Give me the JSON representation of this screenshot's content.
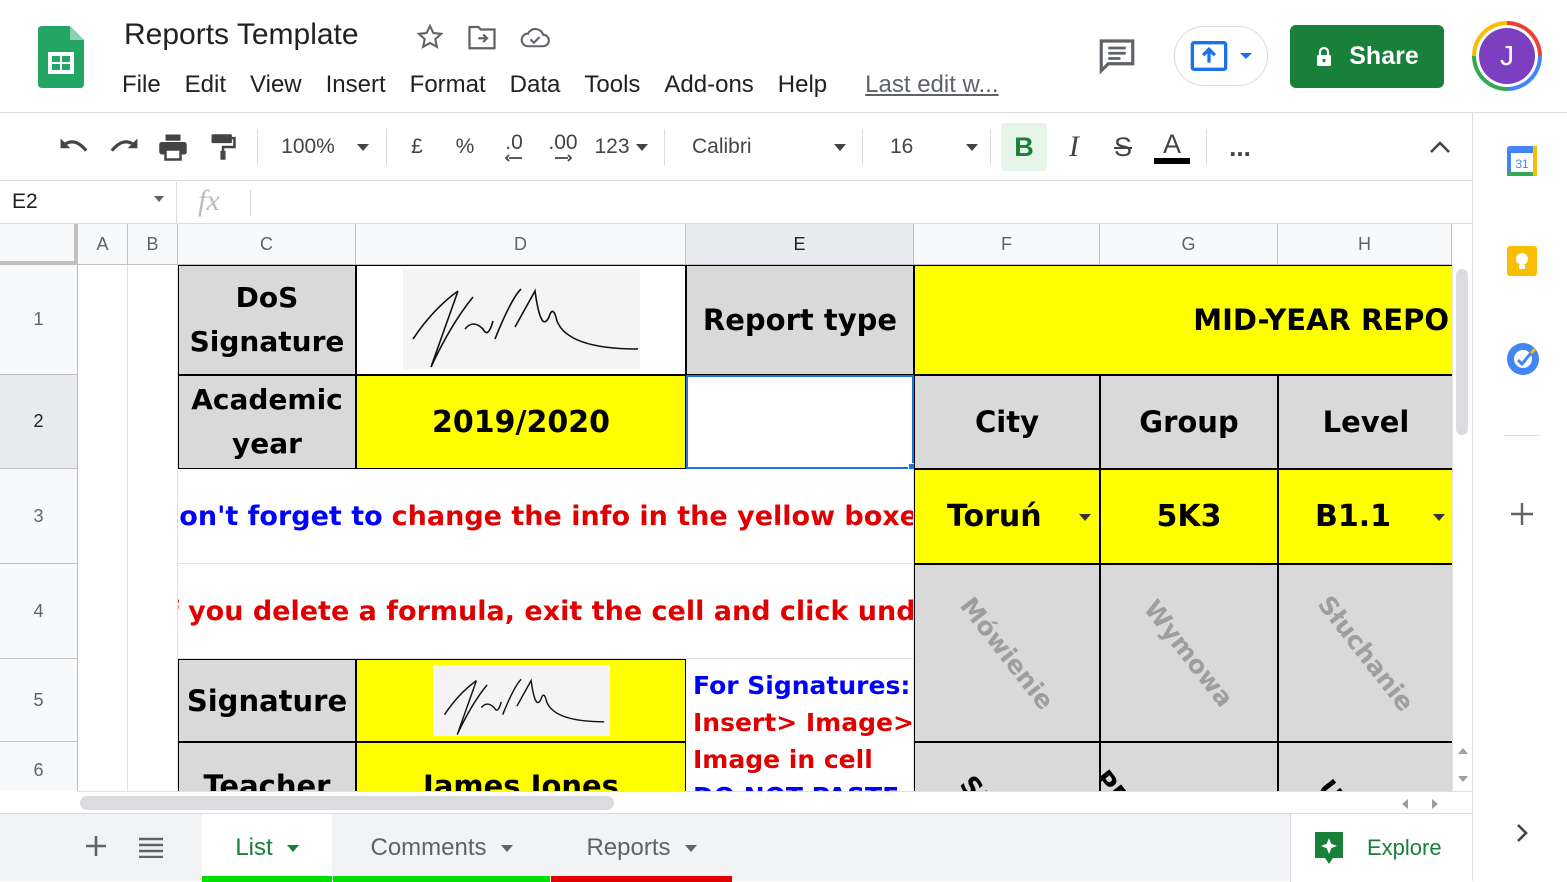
{
  "app": {
    "title": "Reports Template",
    "menu": [
      "File",
      "Edit",
      "View",
      "Insert",
      "Format",
      "Data",
      "Tools",
      "Add-ons",
      "Help"
    ],
    "last_edit": "Last edit w...",
    "share_label": "Share",
    "avatar_initial": "J"
  },
  "toolbar": {
    "zoom": "100%",
    "currency": "£",
    "percent": "%",
    "dec_decrease": ".0",
    "dec_increase": ".00",
    "more_formats": "123",
    "font": "Calibri",
    "font_size": "16",
    "bold": "B",
    "italic": "I",
    "strike": "S",
    "text_color": "A",
    "more": "..."
  },
  "formula_bar": {
    "name_box": "E2",
    "fx": "fx",
    "value": ""
  },
  "grid": {
    "columns": [
      "A",
      "B",
      "C",
      "D",
      "E",
      "F",
      "G",
      "H"
    ],
    "rows": [
      "1",
      "2",
      "3",
      "4",
      "5",
      "6"
    ],
    "selected_cell": "E2",
    "cells": {
      "C1": "DoS Signature",
      "E1": "Report type",
      "F1": "MID-YEAR REPO",
      "C2": "Academic year",
      "D2": "2019/2020",
      "F2": "City",
      "G2": "Group",
      "H2": "Level",
      "C3_blue": "Don't forget to",
      "C3_red": "change the info in the yellow boxes",
      "F3": "Toruń",
      "G3": "5K3",
      "H3": "B1.1",
      "C4": "If you delete a formula, exit the cell and click undo",
      "F4": "Mówienie",
      "G4": "Wymowa",
      "H4": "Słuchanie",
      "C5": "Signature",
      "E5_line1": "For Signatures:",
      "E5_line2": "Insert> Image>",
      "E5_line3": "Image in cell",
      "E5_line4": "DO NOT PASTE",
      "C6": "Teacher",
      "D6": "James Jones",
      "F6": "St",
      "G6": "PRON",
      "H6": "U"
    }
  },
  "sheets": [
    {
      "name": "List",
      "color": "#00e000",
      "active": true
    },
    {
      "name": "Comments",
      "color": "#00e000",
      "active": false
    },
    {
      "name": "Reports",
      "color": "#e00000",
      "active": false
    }
  ],
  "explore_label": "Explore",
  "colors": {
    "accent_green": "#188038",
    "yellow_fill": "#ffff00",
    "gray_fill": "#d9d9d9",
    "blue_text": "#0000ff",
    "red_text": "#e00000",
    "selection": "#1a73e8"
  }
}
